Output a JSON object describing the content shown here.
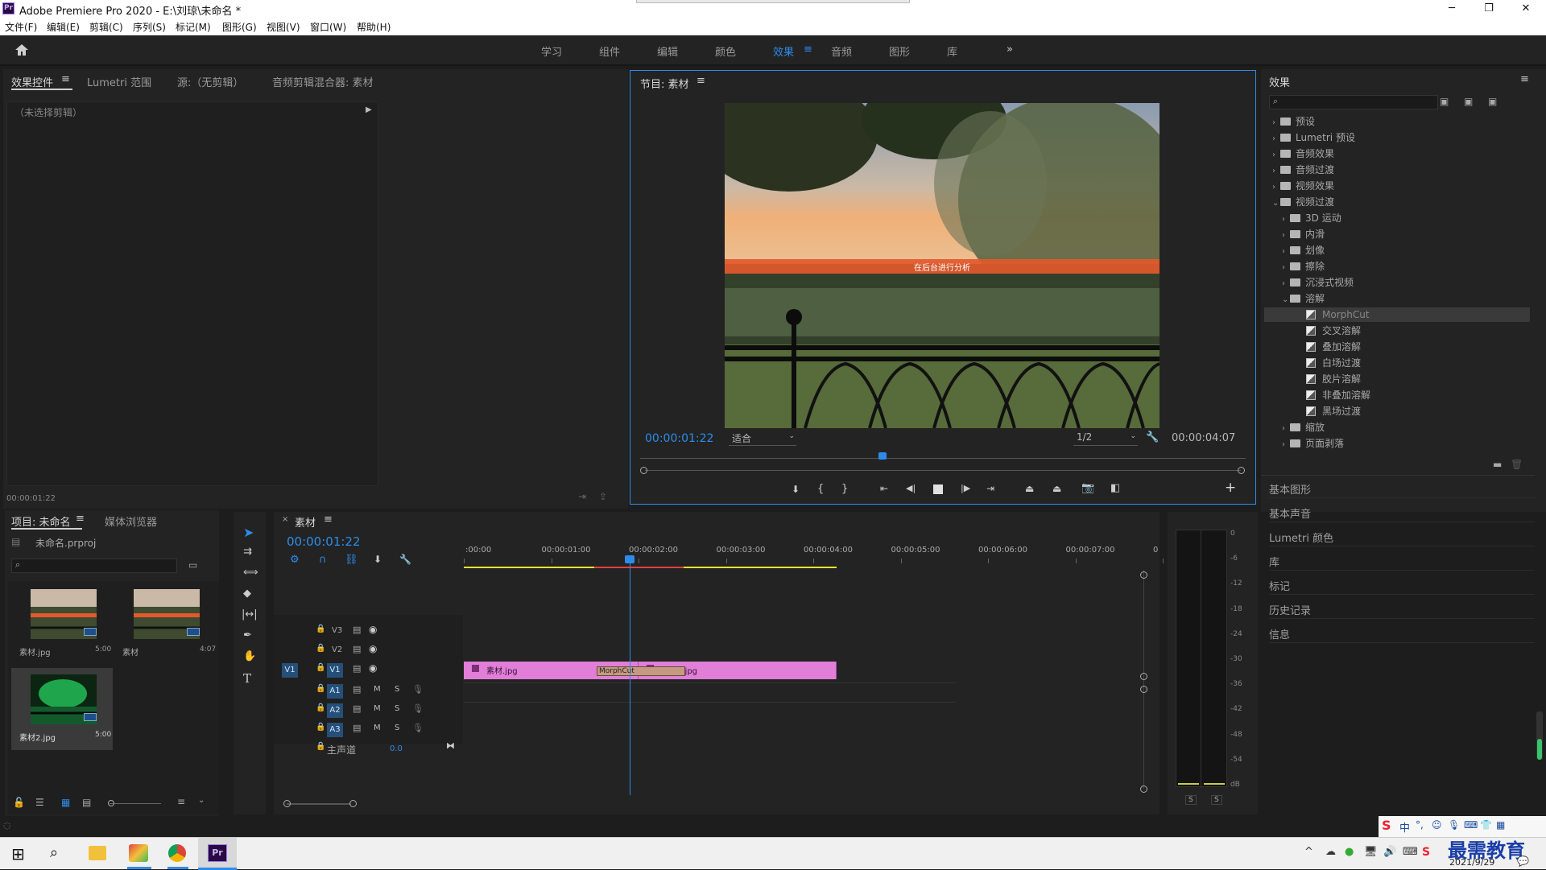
{
  "window": {
    "title": "Adobe Premiere Pro 2020 - E:\\刘琼\\未命名 *",
    "logo": "Pr"
  },
  "menu": [
    "文件(F)",
    "编辑(E)",
    "剪辑(C)",
    "序列(S)",
    "标记(M)",
    "图形(G)",
    "视图(V)",
    "窗口(W)",
    "帮助(H)"
  ],
  "workspaces": [
    "学习",
    "组件",
    "编辑",
    "颜色",
    "效果",
    "音频",
    "图形",
    "库"
  ],
  "active_workspace": "效果",
  "source_panel": {
    "tabs": [
      "效果控件",
      "Lumetri 范围",
      "源:（无剪辑）",
      "音频剪辑混合器: 素材"
    ],
    "no_clip": "（未选择剪辑）",
    "timecode": "00:00:01:22"
  },
  "program": {
    "title": "节目: 素材",
    "overlay_text": "在后台进行分析",
    "timecode": "00:00:01:22",
    "fit": "适合",
    "resolution": "1/2",
    "duration": "00:00:04:07",
    "playhead_fraction": 0.4
  },
  "effects_panel": {
    "title": "效果",
    "items": [
      {
        "label": "预设",
        "level": 0,
        "type": "folder",
        "expanded": false
      },
      {
        "label": "Lumetri 预设",
        "level": 0,
        "type": "folder",
        "expanded": false
      },
      {
        "label": "音频效果",
        "level": 0,
        "type": "folder",
        "expanded": false
      },
      {
        "label": "音频过渡",
        "level": 0,
        "type": "folder",
        "expanded": false
      },
      {
        "label": "视频效果",
        "level": 0,
        "type": "folder",
        "expanded": false
      },
      {
        "label": "视频过渡",
        "level": 0,
        "type": "folder",
        "expanded": true
      },
      {
        "label": "3D 运动",
        "level": 1,
        "type": "folder",
        "expanded": false
      },
      {
        "label": "内滑",
        "level": 1,
        "type": "folder",
        "expanded": false
      },
      {
        "label": "划像",
        "level": 1,
        "type": "folder",
        "expanded": false
      },
      {
        "label": "擦除",
        "level": 1,
        "type": "folder",
        "expanded": false
      },
      {
        "label": "沉浸式视频",
        "level": 1,
        "type": "folder",
        "expanded": false
      },
      {
        "label": "溶解",
        "level": 1,
        "type": "folder",
        "expanded": true
      },
      {
        "label": "MorphCut",
        "level": 2,
        "type": "effect",
        "selected": true
      },
      {
        "label": "交叉溶解",
        "level": 2,
        "type": "effect"
      },
      {
        "label": "叠加溶解",
        "level": 2,
        "type": "effect"
      },
      {
        "label": "白场过渡",
        "level": 2,
        "type": "effect"
      },
      {
        "label": "胶片溶解",
        "level": 2,
        "type": "effect"
      },
      {
        "label": "非叠加溶解",
        "level": 2,
        "type": "effect"
      },
      {
        "label": "黑场过渡",
        "level": 2,
        "type": "effect"
      },
      {
        "label": "缩放",
        "level": 1,
        "type": "folder",
        "expanded": false
      },
      {
        "label": "页面剥落",
        "level": 1,
        "type": "folder",
        "expanded": false
      }
    ],
    "sections": [
      "基本图形",
      "基本声音",
      "Lumetri 颜色",
      "库",
      "标记",
      "历史记录",
      "信息"
    ]
  },
  "project_panel": {
    "tabs": [
      "项目: 未命名",
      "媒体浏览器"
    ],
    "file": "未命名.prproj",
    "items": [
      {
        "name": "素材.jpg",
        "duration": "5:00"
      },
      {
        "name": "素材",
        "duration": "4:07"
      },
      {
        "name": "素材2.jpg",
        "duration": "5:00"
      }
    ]
  },
  "timeline": {
    "title": "素材",
    "timecode": "00:00:01:22",
    "ruler": [
      ":00:00",
      "00:00:01:00",
      "00:00:02:00",
      "00:00:03:00",
      "00:00:04:00",
      "00:00:05:00",
      "00:00:06:00",
      "00:00:07:00",
      "0"
    ],
    "video_tracks": [
      "V3",
      "V2",
      "V1"
    ],
    "audio_tracks": [
      "A1",
      "A2",
      "A3"
    ],
    "source_patch": "V1",
    "master": {
      "label": "主声道",
      "value": "0.0"
    },
    "clips": [
      {
        "name": "素材.jpg",
        "start": 0.0,
        "end": 2.0
      },
      {
        "name": "素材2.jpg",
        "start": 2.0,
        "end": 4.267
      }
    ],
    "transition": {
      "name": "MorphCut"
    },
    "playhead_seconds": 1.9
  },
  "meter": {
    "scale": [
      "0",
      "-6",
      "-12",
      "-18",
      "-24",
      "-30",
      "-36",
      "-42",
      "-48",
      "-54",
      "dB"
    ],
    "buttons": [
      "S",
      "S"
    ]
  },
  "taskbar": {
    "date": "2021/9/29",
    "watermark": "最需教育",
    "ime": "中"
  }
}
